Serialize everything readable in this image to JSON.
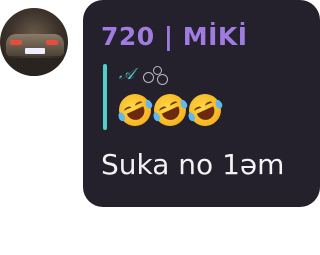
{
  "avatar": {
    "icon": "car-photo-avatar"
  },
  "message": {
    "sender": "720 | MİKİ",
    "reply": {
      "name": "𝒜",
      "bar_color": "#4fd1c9",
      "icon": "bubbles-icon",
      "emojis": [
        "🤣",
        "🤣",
        "🤣"
      ]
    },
    "text": "Suka no 1əm"
  },
  "colors": {
    "bubble_bg": "#24202c",
    "sender": "#a07ce0",
    "reply_accent": "#4fd1c9",
    "text": "#f2f2f2"
  }
}
